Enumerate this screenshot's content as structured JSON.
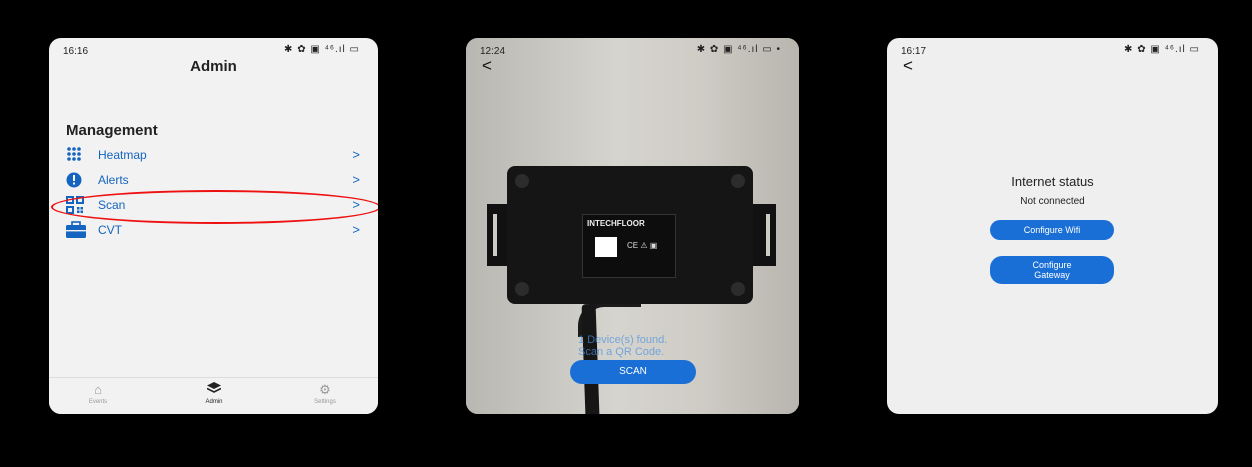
{
  "screen1": {
    "time": "16:16",
    "status_icons": "✱ ✿ ▣ ⁴⁶.ıl ▭",
    "title": "Admin",
    "section": "Management",
    "items": [
      {
        "label": "Heatmap",
        "icon": "grid-dots-icon"
      },
      {
        "label": "Alerts",
        "icon": "alert-circle-icon"
      },
      {
        "label": "Scan",
        "icon": "qr-scan-icon"
      },
      {
        "label": "CVT",
        "icon": "briefcase-icon"
      }
    ],
    "chevron": ">",
    "nav": [
      {
        "label": "Events",
        "icon": "home-icon"
      },
      {
        "label": "Admin",
        "icon": "layers-icon"
      },
      {
        "label": "Settings",
        "icon": "gear-icon"
      }
    ]
  },
  "screen2": {
    "time": "12:24",
    "status_icons": "✱ ✿ ▣ ⁴⁶.ıl ▭ •",
    "back": "<",
    "brand": "INTECHFLOOR",
    "found_line1": "1 Device(s) found.",
    "found_line2": "Scan a QR Code.",
    "scan_button": "SCAN"
  },
  "screen3": {
    "time": "16:17",
    "status_icons": "✱ ✿ ▣ ⁴⁶.ıl ▭",
    "back": "<",
    "status_title": "Internet status",
    "status_value": "Not connected",
    "wifi_button": "Configure Wifi",
    "gateway_button_line1": "Configure",
    "gateway_button_line2": "Gateway"
  },
  "colors": {
    "accent": "#1a6fd6",
    "link": "#1565c0",
    "highlight": "#e11111"
  }
}
